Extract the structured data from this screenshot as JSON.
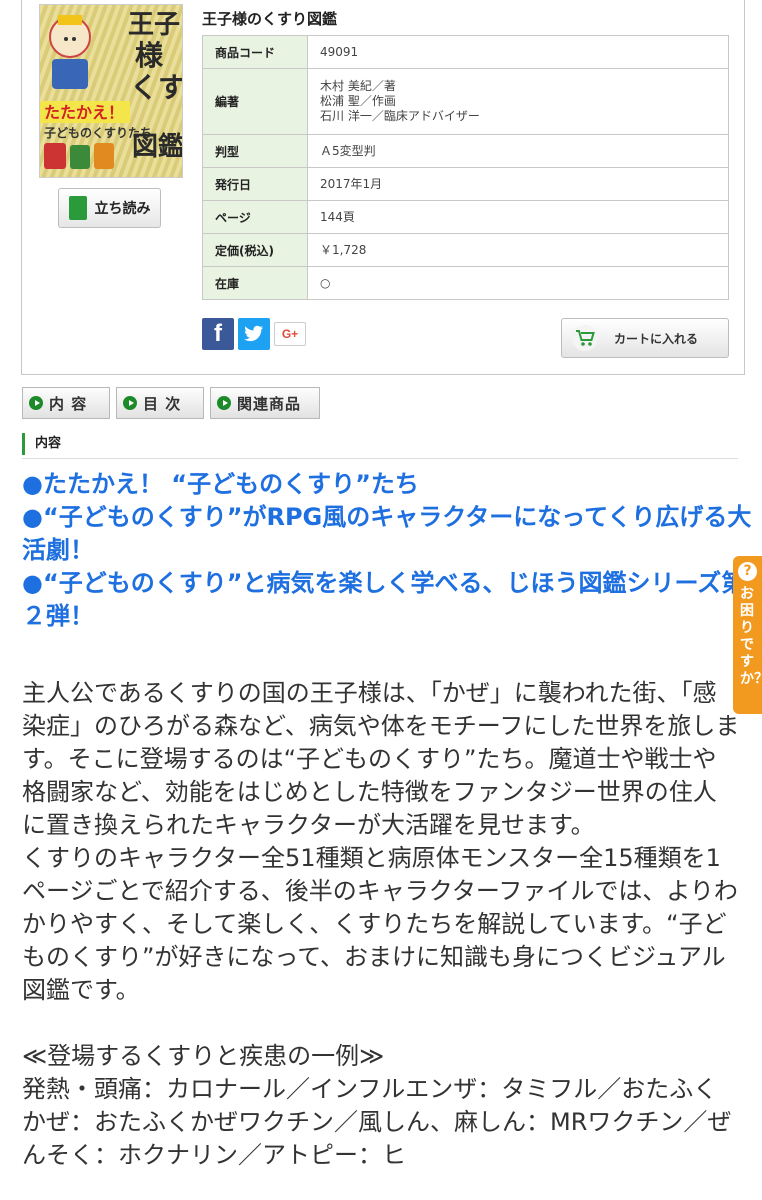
{
  "product": {
    "title": "王子様のくすり図鑑",
    "cover_alt": "王子様のくすり図鑑",
    "tachiyomi_label": "立ち読み",
    "specs": [
      {
        "label": "商品コード",
        "value": "49091"
      },
      {
        "label": "編著",
        "value": "木村 美紀／著\n松浦 聖／作画\n石川 洋一／臨床アドバイザー"
      },
      {
        "label": "判型",
        "value": "Ａ5変型判"
      },
      {
        "label": "発行日",
        "value": "2017年1月"
      },
      {
        "label": "ページ",
        "value": "144頁"
      },
      {
        "label": "定価(税込)",
        "value": "￥1,728"
      },
      {
        "label": "在庫",
        "value": "○"
      }
    ],
    "cart_label": "カートに入れる",
    "social": {
      "facebook": "f",
      "googleplus": "G+"
    }
  },
  "tabs": [
    {
      "label": "内 容"
    },
    {
      "label": "目 次"
    },
    {
      "label": "関連商品"
    }
  ],
  "section": {
    "heading": "内容"
  },
  "highlights": [
    "●たたかえ！ “子どものくすり”たち",
    "●“子どものくすり”がRPG風のキャラクターになってくり広げる大活劇！",
    "●“子どものくすり”と病気を楽しく学べる、じほう図鑑シリーズ第２弾！"
  ],
  "body": {
    "paragraph1": "主人公であるくすりの国の王子様は、「かぜ」に襲われた街、「感染症」のひろがる森など、病気や体をモチーフにした世界を旅します。そこに登場するのは“子どものくすり”たち。魔道士や戦士や格闘家など、効能をはじめとした特徴をファンタジー世界の住人に置き換えられたキャラクターが大活躍を見せます。",
    "paragraph2": "くすりのキャラクター全51種類と病原体モンスター全15種類を1ページごとで紹介する、後半のキャラクターファイルでは、よりわかりやすく、そして楽しく、くすりたちを解説しています。“子どものくすり”が好きになって、おまけに知識も身につくビジュアル図鑑です。",
    "list_title": "≪登場するくすりと疾患の一例≫",
    "list_text": "発熱・頭痛：カロナール／インフルエンザ：タミフル／おたふくかぜ：おたふくかぜワクチン／風しん、麻しん：MRワクチン／ぜんそく：ホクナリン／アトピー：ヒ"
  },
  "help": {
    "q": "?",
    "text": "お困りですか？"
  },
  "colors": {
    "accent_green": "#2c9a3a",
    "highlight_blue": "#1e6fe0",
    "help_orange": "#f29a1f"
  }
}
